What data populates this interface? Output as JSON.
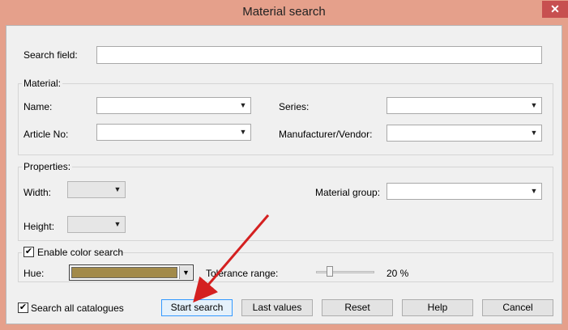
{
  "window": {
    "title": "Material search",
    "close_glyph": "✕"
  },
  "search": {
    "label": "Search field:",
    "value": ""
  },
  "material": {
    "group_title": "Material:",
    "name_label": "Name:",
    "name_value": "",
    "article_label": "Article No:",
    "article_value": "",
    "series_label": "Series:",
    "series_value": "",
    "manufacturer_label": "Manufacturer/Vendor:",
    "manufacturer_value": ""
  },
  "properties": {
    "group_title": "Properties:",
    "width_label": "Width:",
    "width_value": "",
    "height_label": "Height:",
    "height_value": "",
    "material_group_label": "Material group:",
    "material_group_value": ""
  },
  "color": {
    "enable_label": "Enable color search",
    "enable_checked": "✔",
    "hue_label": "Hue:",
    "hue_color": "#a28a4a",
    "tolerance_label": "Tolerance range:",
    "tolerance_value": "20 %",
    "tolerance_level": 0.2
  },
  "footer": {
    "search_all_label": "Search all catalogues",
    "search_all_checked": "✔",
    "start_search": "Start search",
    "last_values": "Last values",
    "reset": "Reset",
    "help": "Help",
    "cancel": "Cancel"
  },
  "icons": {
    "dropdown": "▼",
    "pointer_color": "#d42020"
  }
}
